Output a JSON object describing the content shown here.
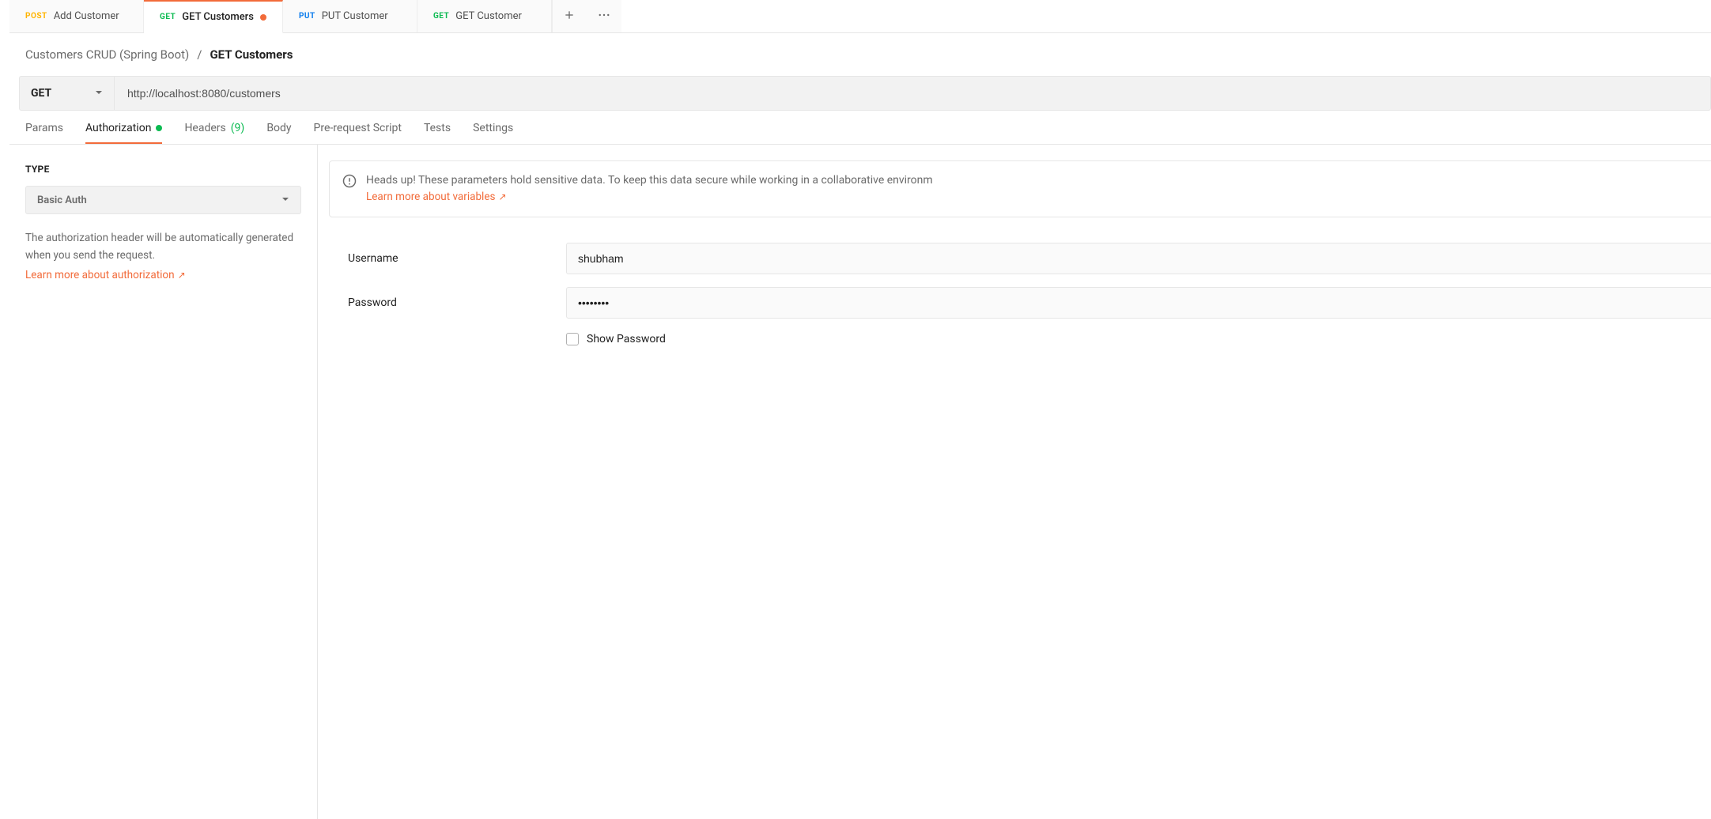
{
  "tabs": [
    {
      "method": "POST",
      "label": "Add Customer",
      "modified": false,
      "active": false
    },
    {
      "method": "GET",
      "label": "GET Customers",
      "modified": true,
      "active": true
    },
    {
      "method": "PUT",
      "label": "PUT Customer",
      "modified": false,
      "active": false
    },
    {
      "method": "GET",
      "label": "GET Customer",
      "modified": false,
      "active": false
    }
  ],
  "breadcrumb": {
    "parent": "Customers CRUD (Spring Boot)",
    "sep": "/",
    "current": "GET Customers"
  },
  "request": {
    "method": "GET",
    "url": "http://localhost:8080/customers"
  },
  "subtabs": {
    "params": "Params",
    "authorization": "Authorization",
    "headers": "Headers",
    "headers_count": "(9)",
    "body": "Body",
    "pre_request": "Pre-request Script",
    "tests": "Tests",
    "settings": "Settings"
  },
  "auth": {
    "type_label": "TYPE",
    "type_value": "Basic Auth",
    "description": "The authorization header will be automatically generated when you send the request.",
    "learn_more": "Learn more about authorization",
    "alert_text": "Heads up! These parameters hold sensitive data. To keep this data secure while working in a collaborative environm",
    "alert_link": "Learn more about variables",
    "username_label": "Username",
    "username_value": "shubham",
    "password_label": "Password",
    "password_value": "••••••••",
    "show_password": "Show Password"
  }
}
